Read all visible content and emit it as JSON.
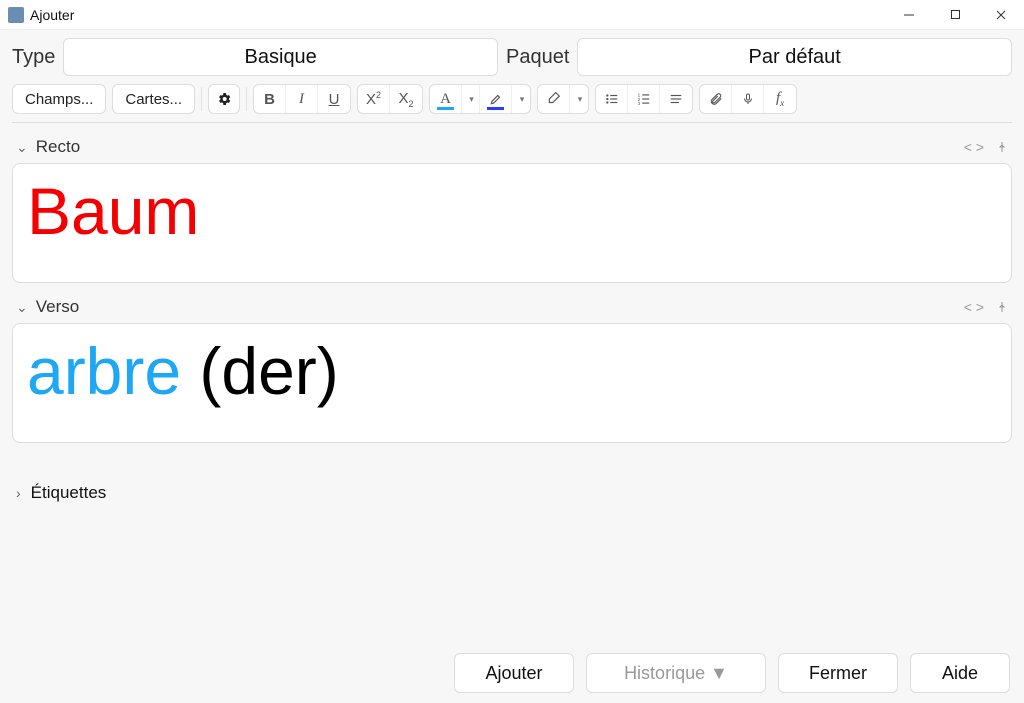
{
  "window": {
    "title": "Ajouter"
  },
  "top": {
    "type_label": "Type",
    "type_value": "Basique",
    "deck_label": "Paquet",
    "deck_value": "Par défaut"
  },
  "toolbar": {
    "fields_btn": "Champs...",
    "cards_btn": "Cartes...",
    "text_color": "#1ea7f5",
    "highlight_color": "#2a3dff"
  },
  "fields": {
    "recto": {
      "label": "Recto",
      "content": "Baum",
      "color": "#f40000"
    },
    "verso": {
      "label": "Verso",
      "word1": "arbre",
      "word2": " (der)"
    }
  },
  "tags": {
    "label": "Étiquettes"
  },
  "bottom": {
    "add": "Ajouter",
    "history": "Historique ▼",
    "close": "Fermer",
    "help": "Aide"
  }
}
